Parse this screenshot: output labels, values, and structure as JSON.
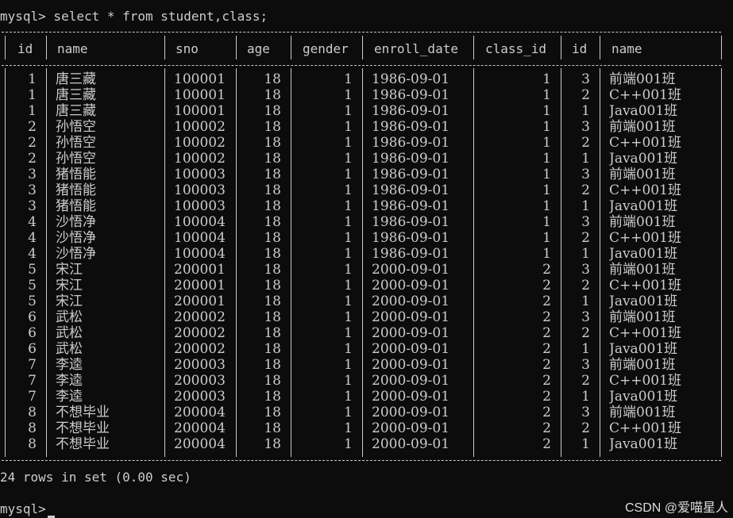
{
  "terminal": {
    "prompt": "mysql>",
    "command": " select * from student,class;",
    "result_summary": "24 rows in set (0.00 sec)",
    "prompt2": "mysql>",
    "watermark": "CSDN @爱喵星人"
  },
  "table": {
    "columns": [
      "id",
      "name",
      "sno",
      "age",
      "gender",
      "enroll_date",
      "class_id",
      "id",
      "name"
    ],
    "rows": [
      [
        "1",
        "唐三藏",
        "100001",
        "18",
        "1",
        "1986-09-01",
        "1",
        "3",
        "前端001班"
      ],
      [
        "1",
        "唐三藏",
        "100001",
        "18",
        "1",
        "1986-09-01",
        "1",
        "2",
        "C++001班"
      ],
      [
        "1",
        "唐三藏",
        "100001",
        "18",
        "1",
        "1986-09-01",
        "1",
        "1",
        "Java001班"
      ],
      [
        "2",
        "孙悟空",
        "100002",
        "18",
        "1",
        "1986-09-01",
        "1",
        "3",
        "前端001班"
      ],
      [
        "2",
        "孙悟空",
        "100002",
        "18",
        "1",
        "1986-09-01",
        "1",
        "2",
        "C++001班"
      ],
      [
        "2",
        "孙悟空",
        "100002",
        "18",
        "1",
        "1986-09-01",
        "1",
        "1",
        "Java001班"
      ],
      [
        "3",
        "猪悟能",
        "100003",
        "18",
        "1",
        "1986-09-01",
        "1",
        "3",
        "前端001班"
      ],
      [
        "3",
        "猪悟能",
        "100003",
        "18",
        "1",
        "1986-09-01",
        "1",
        "2",
        "C++001班"
      ],
      [
        "3",
        "猪悟能",
        "100003",
        "18",
        "1",
        "1986-09-01",
        "1",
        "1",
        "Java001班"
      ],
      [
        "4",
        "沙悟净",
        "100004",
        "18",
        "1",
        "1986-09-01",
        "1",
        "3",
        "前端001班"
      ],
      [
        "4",
        "沙悟净",
        "100004",
        "18",
        "1",
        "1986-09-01",
        "1",
        "2",
        "C++001班"
      ],
      [
        "4",
        "沙悟净",
        "100004",
        "18",
        "1",
        "1986-09-01",
        "1",
        "1",
        "Java001班"
      ],
      [
        "5",
        "宋江",
        "200001",
        "18",
        "1",
        "2000-09-01",
        "2",
        "3",
        "前端001班"
      ],
      [
        "5",
        "宋江",
        "200001",
        "18",
        "1",
        "2000-09-01",
        "2",
        "2",
        "C++001班"
      ],
      [
        "5",
        "宋江",
        "200001",
        "18",
        "1",
        "2000-09-01",
        "2",
        "1",
        "Java001班"
      ],
      [
        "6",
        "武松",
        "200002",
        "18",
        "1",
        "2000-09-01",
        "2",
        "3",
        "前端001班"
      ],
      [
        "6",
        "武松",
        "200002",
        "18",
        "1",
        "2000-09-01",
        "2",
        "2",
        "C++001班"
      ],
      [
        "6",
        "武松",
        "200002",
        "18",
        "1",
        "2000-09-01",
        "2",
        "1",
        "Java001班"
      ],
      [
        "7",
        "李逵",
        "200003",
        "18",
        "1",
        "2000-09-01",
        "2",
        "3",
        "前端001班"
      ],
      [
        "7",
        "李逵",
        "200003",
        "18",
        "1",
        "2000-09-01",
        "2",
        "2",
        "C++001班"
      ],
      [
        "7",
        "李逵",
        "200003",
        "18",
        "1",
        "2000-09-01",
        "2",
        "1",
        "Java001班"
      ],
      [
        "8",
        "不想毕业",
        "200004",
        "18",
        "1",
        "2000-09-01",
        "2",
        "3",
        "前端001班"
      ],
      [
        "8",
        "不想毕业",
        "200004",
        "18",
        "1",
        "2000-09-01",
        "2",
        "2",
        "C++001班"
      ],
      [
        "8",
        "不想毕业",
        "200004",
        "18",
        "1",
        "2000-09-01",
        "2",
        "1",
        "Java001班"
      ]
    ]
  },
  "colors": {
    "background": "#0c0c0c",
    "text": "#cccccc"
  }
}
